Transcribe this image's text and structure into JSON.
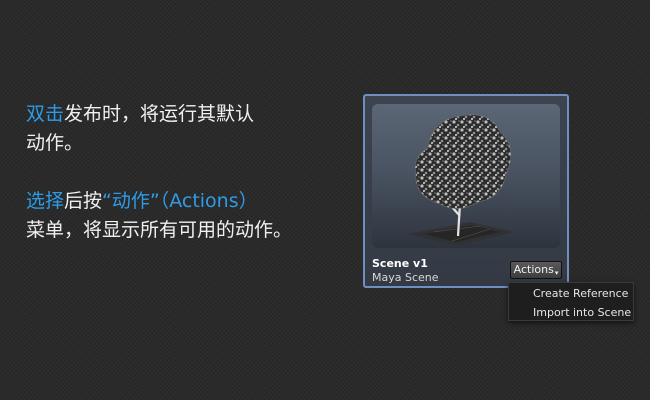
{
  "instructions": {
    "p1": {
      "hl_doubleclick": "双击",
      "t1": "发布时，将运行其默认",
      "t2": "动作。"
    },
    "p2": {
      "hl_select": "选择",
      "t3": "后按",
      "hl_actions": "“动作”（Actions）",
      "t4": "菜单，将显示所有可用的动作。"
    }
  },
  "card": {
    "title": "Scene v1",
    "subtitle": "Maya Scene",
    "actions_label": "Actions",
    "caret": "▾",
    "thumbnail_icon": "tree-thumbnail"
  },
  "menu": {
    "items": [
      {
        "label": "Create Reference"
      },
      {
        "label": "Import into Scene"
      }
    ]
  },
  "colors": {
    "highlight": "#2d9ce8",
    "card_border": "#6f8fc0",
    "background": "#2a2a2a"
  }
}
